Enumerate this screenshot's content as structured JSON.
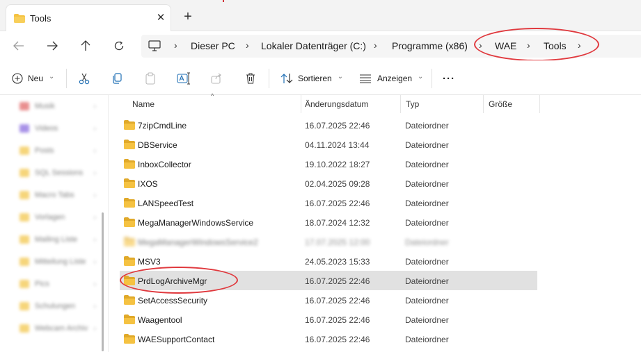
{
  "tab": {
    "title": "Tools",
    "close_glyph": "✕",
    "new_glyph": "+"
  },
  "nav": {
    "back": "back-arrow-icon",
    "forward": "forward-arrow-icon",
    "up": "up-arrow-icon",
    "refresh": "refresh-icon"
  },
  "breadcrumb": {
    "items": [
      "Dieser PC",
      "Lokaler Datenträger (C:)",
      "Programme (x86)",
      "WAE",
      "Tools"
    ],
    "separator": "›",
    "trailing": "›"
  },
  "commands": {
    "new_label": "Neu",
    "sort_label": "Sortieren",
    "view_label": "Anzeigen",
    "more_label": "···",
    "dropdown_glyph": "⌄"
  },
  "sidebar": {
    "items": [
      {
        "label": "Musik",
        "color": "#e26a6a"
      },
      {
        "label": "Videos",
        "color": "#8b6de0"
      },
      {
        "label": "Posts",
        "color": "#f3c74e"
      },
      {
        "label": "SQL Sessions",
        "color": "#f3c74e"
      },
      {
        "label": "Macro Tabs",
        "color": "#f3c74e"
      },
      {
        "label": "Vorlagen",
        "color": "#f3c74e"
      },
      {
        "label": "Mailing Liste",
        "color": "#f3c74e"
      },
      {
        "label": "Mitteilung Liste",
        "color": "#f3c74e"
      },
      {
        "label": "Pics",
        "color": "#f3c74e"
      },
      {
        "label": "Schulungen",
        "color": "#f3c74e"
      },
      {
        "label": "Webcam Archiv",
        "color": "#f3c74e"
      }
    ]
  },
  "columns": {
    "name": "Name",
    "date": "Änderungsdatum",
    "type": "Typ",
    "size": "Größe"
  },
  "files": [
    {
      "name": "7zipCmdLine",
      "date": "16.07.2025 22:46",
      "type": "Dateiordner"
    },
    {
      "name": "DBService",
      "date": "04.11.2024 13:44",
      "type": "Dateiordner"
    },
    {
      "name": "InboxCollector",
      "date": "19.10.2022 18:27",
      "type": "Dateiordner"
    },
    {
      "name": "IXOS",
      "date": "02.04.2025 09:28",
      "type": "Dateiordner"
    },
    {
      "name": "LANSpeedTest",
      "date": "16.07.2025 22:46",
      "type": "Dateiordner"
    },
    {
      "name": "MegaManagerWindowsService",
      "date": "18.07.2024 12:32",
      "type": "Dateiordner"
    },
    {
      "name": "MegaManagerWindowsService2",
      "date": "17.07.2025 12:00",
      "type": "Dateiordner"
    },
    {
      "name": "MSV3",
      "date": "24.05.2023 15:33",
      "type": "Dateiordner"
    },
    {
      "name": "PrdLogArchiveMgr",
      "date": "16.07.2025 22:46",
      "type": "Dateiordner"
    },
    {
      "name": "SetAccessSecurity",
      "date": "16.07.2025 22:46",
      "type": "Dateiordner"
    },
    {
      "name": "Waagentool",
      "date": "16.07.2025 22:46",
      "type": "Dateiordner"
    },
    {
      "name": "WAESupportContact",
      "date": "16.07.2025 22:46",
      "type": "Dateiordner"
    }
  ],
  "colors": {
    "folder": "#f5c242",
    "folder_dark": "#e0a92a",
    "highlight_ring": "#e0393e",
    "selection": "#e1e1e1",
    "accent": "#0067c0"
  }
}
